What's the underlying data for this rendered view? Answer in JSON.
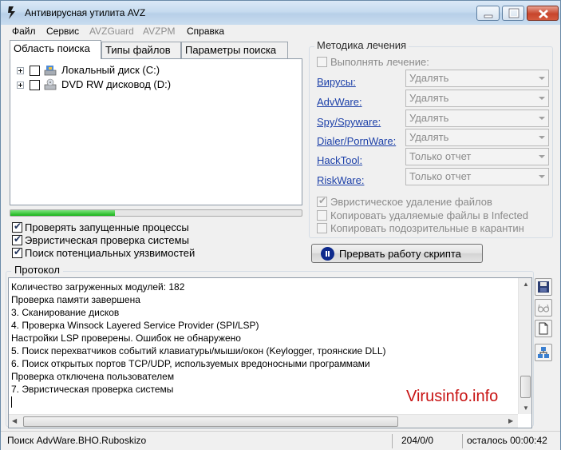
{
  "window": {
    "title": "Антивирусная утилита AVZ"
  },
  "menu": [
    {
      "label": "Файл",
      "enabled": true
    },
    {
      "label": "Сервис",
      "enabled": true
    },
    {
      "label": "AVZGuard",
      "enabled": false
    },
    {
      "label": "AVZPM",
      "enabled": false
    },
    {
      "label": "Справка",
      "enabled": true
    }
  ],
  "tabs": [
    {
      "label": "Область поиска",
      "active": true
    },
    {
      "label": "Типы файлов",
      "active": false
    },
    {
      "label": "Параметры поиска",
      "active": false
    }
  ],
  "drives": [
    {
      "label": "Локальный диск (C:)",
      "icon": "hard-drive-icon",
      "checked": false
    },
    {
      "label": "DVD RW дисковод (D:)",
      "icon": "dvd-drive-icon",
      "checked": false
    }
  ],
  "scan_progress_percent": 36,
  "scan_options": [
    {
      "label": "Проверять запущенные процессы",
      "checked": true
    },
    {
      "label": "Эвристическая проверка системы",
      "checked": true
    },
    {
      "label": "Поиск потенциальных уязвимостей",
      "checked": true
    }
  ],
  "treatment": {
    "title": "Методика лечения",
    "perform_label": "Выполнять лечение:",
    "perform_checked": false,
    "rows": [
      {
        "link": "Вирусы:",
        "value": "Удалять"
      },
      {
        "link": "AdvWare:",
        "value": "Удалять"
      },
      {
        "link": "Spy/Spyware:",
        "value": "Удалять"
      },
      {
        "link": "Dialer/PornWare:",
        "value": "Удалять"
      },
      {
        "link": "HackTool:",
        "value": "Только отчет"
      },
      {
        "link": "RiskWare:",
        "value": "Только отчет"
      }
    ],
    "options": [
      {
        "label": "Эвристическое удаление файлов",
        "checked": true
      },
      {
        "label": "Копировать удаляемые файлы в  Infected",
        "checked": false
      },
      {
        "label": "Копировать подозрительные в  карантин",
        "checked": false
      }
    ]
  },
  "stop_button": {
    "label": "Прервать работу скрипта"
  },
  "protocol": {
    "title": "Протокол",
    "lines": [
      " Количество загруженных модулей: 182",
      "Проверка памяти завершена",
      "3. Сканирование дисков",
      "4. Проверка Winsock Layered Service Provider (SPI/LSP)",
      " Настройки LSP проверены. Ошибок не обнаружено",
      "5. Поиск перехватчиков событий клавиатуры/мыши/окон (Keylogger, троянские DLL)",
      "6. Поиск открытых портов TCP/UDP, используемых вредоносными программами",
      " Проверка отключена пользователем",
      "7. Эвристическая проверка системы"
    ],
    "watermark": "Virusinfo.info"
  },
  "side_buttons": [
    "save-icon",
    "glasses-icon",
    "document-icon",
    "network-icon"
  ],
  "status": {
    "current": "Поиск AdvWare.BHO.Ruboskizo",
    "counts": "204/0/0",
    "remaining": "осталось 00:00:42"
  },
  "colors": {
    "link": "#1b3fa8",
    "watermark": "#c81414",
    "progress": "#18b318"
  }
}
